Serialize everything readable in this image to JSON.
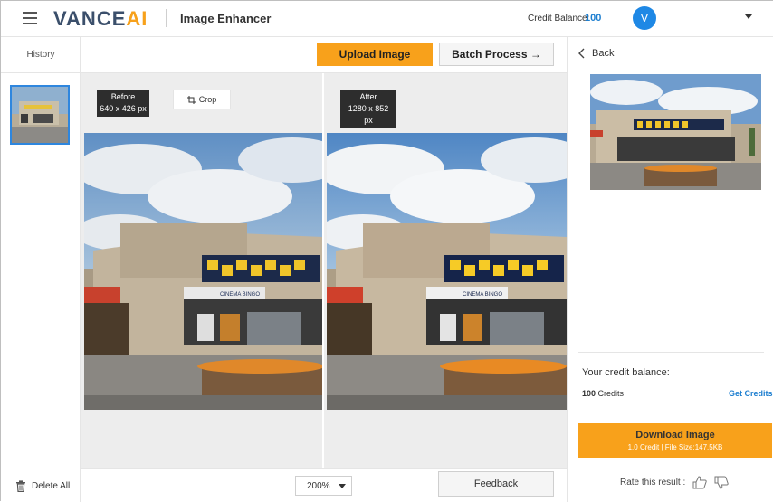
{
  "header": {
    "logo_part1": "VANCE",
    "logo_part2": "AI",
    "app_title": "Image Enhancer",
    "credit_label": "Credit Balance:",
    "credit_value": "100",
    "avatar_letter": "V"
  },
  "sidebar": {
    "history_label": "History",
    "delete_all": "Delete All"
  },
  "toolbar": {
    "upload_label": "Upload Image",
    "batch_label": "Batch Process →"
  },
  "compare": {
    "before_title": "Before",
    "before_size": "640 x 426 px",
    "after_title": "After",
    "after_size": "1280 x 852 px",
    "crop_label": "Crop",
    "sign_text": "CINEMA BINGO"
  },
  "bottom": {
    "zoom_value": "200%",
    "feedback_label": "Feedback"
  },
  "right_panel": {
    "back_label": "Back",
    "your_credit_label": "Your credit balance:",
    "credits_number": "100",
    "credits_word": "Credits",
    "get_credits": "Get Credits",
    "download_label": "Download Image",
    "download_sub": "1.0 Credit | File Size:147.5KB",
    "rate_label": "Rate this result :"
  },
  "colors": {
    "accent_orange": "#f8a11b",
    "link_blue": "#1e7fd0",
    "avatar_blue": "#1e88e5"
  }
}
